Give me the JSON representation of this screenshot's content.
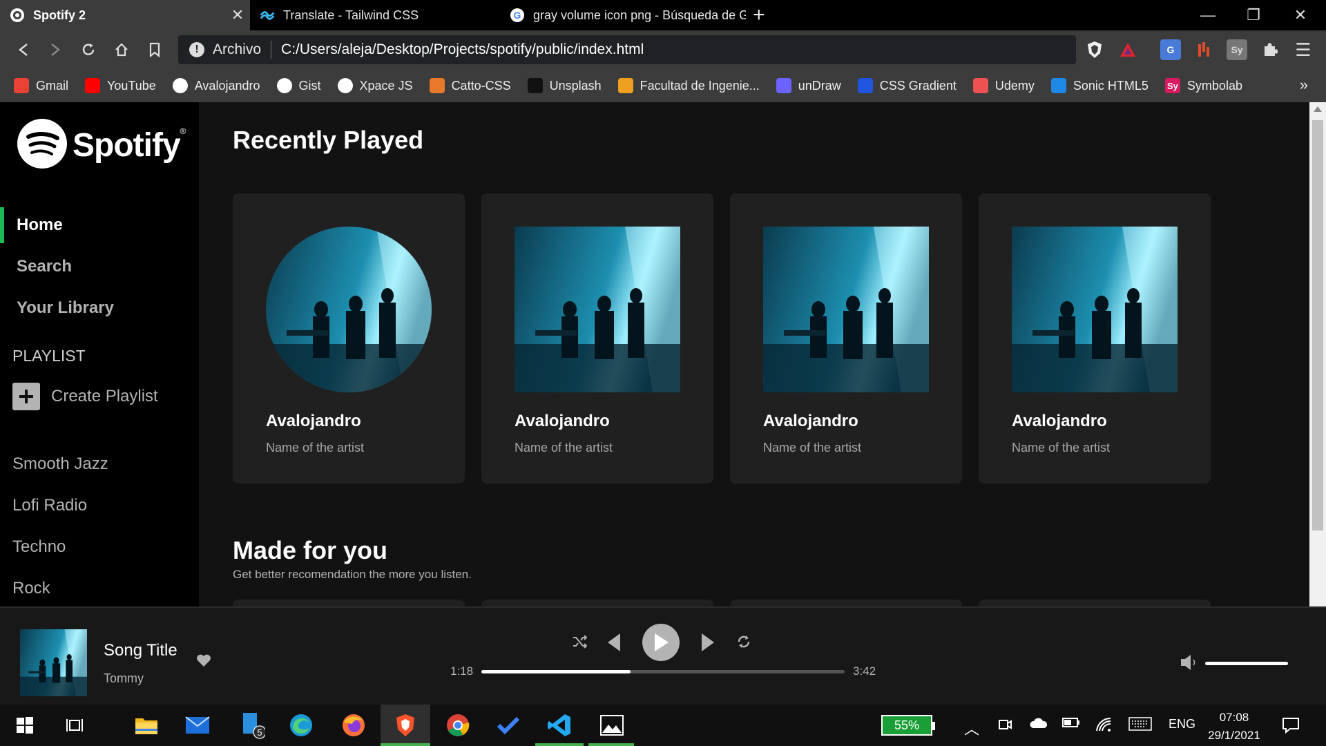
{
  "browser": {
    "tabs": [
      {
        "title": "Spotify 2",
        "active": true
      },
      {
        "title": "Translate - Tailwind CSS",
        "active": false
      },
      {
        "title": "gray volume icon png - Búsqueda de Google",
        "active": false
      }
    ],
    "address": {
      "protocol_label": "Archivo",
      "url": "C:/Users/aleja/Desktop/Projects/spotify/public/index.html"
    },
    "bookmarks": [
      {
        "label": "Gmail",
        "icon": "gmail-icon",
        "color": "#ea4335"
      },
      {
        "label": "YouTube",
        "icon": "youtube-icon",
        "color": "#ff0000"
      },
      {
        "label": "Avalojandro",
        "icon": "github-icon",
        "color": "#3c3c3c"
      },
      {
        "label": "Gist",
        "icon": "github-icon",
        "color": "#3c3c3c"
      },
      {
        "label": "Xpace JS",
        "icon": "github-icon",
        "color": "#3c3c3c"
      },
      {
        "label": "Catto-CSS",
        "icon": "cat-icon",
        "color": "#e8792b"
      },
      {
        "label": "Unsplash",
        "icon": "unsplash-icon",
        "color": "#111111"
      },
      {
        "label": "Facultad de Ingenie...",
        "icon": "university-icon",
        "color": "#f0a020"
      },
      {
        "label": "unDraw",
        "icon": "undraw-icon",
        "color": "#6c63ff"
      },
      {
        "label": "CSS Gradient",
        "icon": "gradient-icon",
        "color": "#2255dd"
      },
      {
        "label": "Udemy",
        "icon": "udemy-icon",
        "color": "#ec5252"
      },
      {
        "label": "Sonic HTML5",
        "icon": "sonic-icon",
        "color": "#1e88e5"
      },
      {
        "label": "Symbolab",
        "icon": "symbolab-icon",
        "color": "#d81b60",
        "text": "Sy"
      }
    ]
  },
  "sidebar": {
    "logo": "Spotify",
    "logo_mark": "®",
    "nav": [
      {
        "label": "Home",
        "active": true
      },
      {
        "label": "Search",
        "active": false
      },
      {
        "label": "Your Library",
        "active": false
      }
    ],
    "playlist_heading": "PLAYLIST",
    "create_playlist": "Create Playlist",
    "playlists": [
      "Smooth Jazz",
      "Lofi Radio",
      "Techno",
      "Rock"
    ]
  },
  "main": {
    "recently_played_title": "Recently Played",
    "cards": [
      {
        "title": "Avalojandro",
        "subtitle": "Name of the artist",
        "round": true
      },
      {
        "title": "Avalojandro",
        "subtitle": "Name of the artist",
        "round": false
      },
      {
        "title": "Avalojandro",
        "subtitle": "Name of the artist",
        "round": false
      },
      {
        "title": "Avalojandro",
        "subtitle": "Name of the artist",
        "round": false
      }
    ],
    "made_for_you_title": "Made for you",
    "made_for_you_subtitle": "Get better recomendation the more you listen."
  },
  "player": {
    "song_title": "Song Title",
    "artist": "Tommy",
    "current_time": "1:18",
    "total_time": "3:42",
    "progress": 0.41,
    "volume": 1.0
  },
  "taskbar": {
    "battery": "55%",
    "mail_badge": "5",
    "language": "ENG",
    "time": "07:08",
    "date": "29/1/2021"
  },
  "colors": {
    "accent": "#1db954",
    "background": "#121212",
    "card": "#202020",
    "sidebar": "#000000"
  }
}
